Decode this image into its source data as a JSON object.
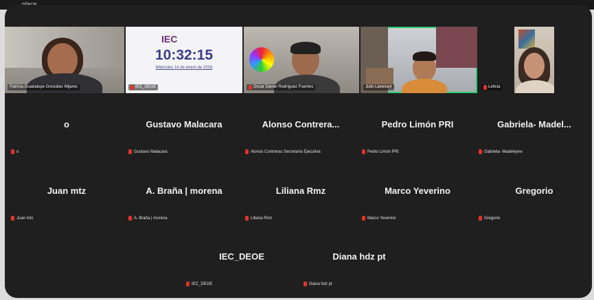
{
  "window": {
    "title": "place"
  },
  "video_tiles": [
    {
      "name": "Patricia Guadalupe González Mijares"
    },
    {
      "name": "IEC_DEOE",
      "slide": {
        "logo": "IEC",
        "clock": "10:32:15",
        "date": "Miércoles 14 de enero de 2026"
      }
    },
    {
      "name": "Oscar Daniel Rodríguez Fuentes"
    },
    {
      "name": "Julio Lavenant"
    },
    {
      "name": "Leticia"
    }
  ],
  "name_tiles": [
    {
      "display": "o",
      "label": "o"
    },
    {
      "display": "Gustavo Malacara",
      "label": "Gustavo Malacara"
    },
    {
      "display": "Alonso  Contrera...",
      "label": "Alonso Contreras Secretaría Ejecutiva"
    },
    {
      "display": "Pedro Limón PRI",
      "label": "Pedro Limón PRI"
    },
    {
      "display": "Gabriela-  Madel...",
      "label": "Gabriela- Madeleyne"
    },
    {
      "display": "Juan mtz",
      "label": "Juan mtz"
    },
    {
      "display": "A. Braña | morena",
      "label": "A. Braña | morena"
    },
    {
      "display": "Liliana Rmz",
      "label": "Liliana Rmz"
    },
    {
      "display": "Marco Yeverino",
      "label": "Marco Yeverino"
    },
    {
      "display": "Gregorio",
      "label": "Gregorio"
    },
    {
      "display": "IEC_DEOE",
      "label": "IEC_DEOE"
    },
    {
      "display": "Diana hdz pt",
      "label": "Diana hdz pt"
    }
  ],
  "icons": {
    "muted": "mic-muted-icon"
  },
  "colors": {
    "muted": "#e0332a",
    "active_speaker": "#2ecc71",
    "background": "#1f1f1f"
  }
}
